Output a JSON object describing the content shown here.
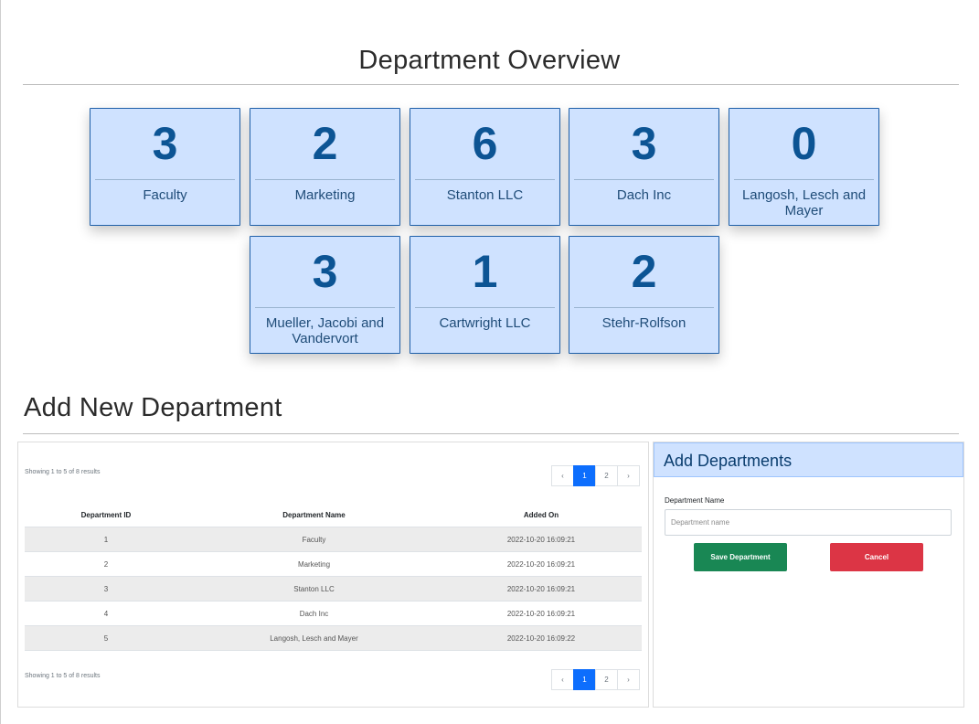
{
  "overview": {
    "title": "Department Overview",
    "cards": [
      {
        "count": "3",
        "name": "Faculty"
      },
      {
        "count": "2",
        "name": "Marketing"
      },
      {
        "count": "6",
        "name": "Stanton LLC"
      },
      {
        "count": "3",
        "name": "Dach Inc"
      },
      {
        "count": "0",
        "name": "Langosh, Lesch and Mayer"
      },
      {
        "count": "3",
        "name": "Mueller, Jacobi and Vandervort"
      },
      {
        "count": "1",
        "name": "Cartwright LLC"
      },
      {
        "count": "2",
        "name": "Stehr-Rolfson"
      }
    ]
  },
  "add_section": {
    "title": "Add New Department"
  },
  "table": {
    "showing_text": "Showing 1 to 5 of 8 results",
    "pager": {
      "prev": "‹",
      "pages": [
        "1",
        "2"
      ],
      "current": "1",
      "next": "›"
    },
    "headers": [
      "Department ID",
      "Department Name",
      "Added On"
    ],
    "rows": [
      [
        "1",
        "Faculty",
        "2022-10-20 16:09:21"
      ],
      [
        "2",
        "Marketing",
        "2022-10-20 16:09:21"
      ],
      [
        "3",
        "Stanton LLC",
        "2022-10-20 16:09:21"
      ],
      [
        "4",
        "Dach Inc",
        "2022-10-20 16:09:21"
      ],
      [
        "5",
        "Langosh, Lesch and Mayer",
        "2022-10-20 16:09:22"
      ]
    ]
  },
  "form": {
    "title": "Add Departments",
    "label": "Department Name",
    "placeholder": "Department name",
    "value": "",
    "save_label": "Save Department",
    "cancel_label": "Cancel"
  },
  "colors": {
    "card_bg": "#cfe2ff",
    "card_border": "#1e5fa8",
    "count_text": "#0c5494",
    "primary": "#0d6efd",
    "success": "#198754",
    "danger": "#dc3545"
  }
}
